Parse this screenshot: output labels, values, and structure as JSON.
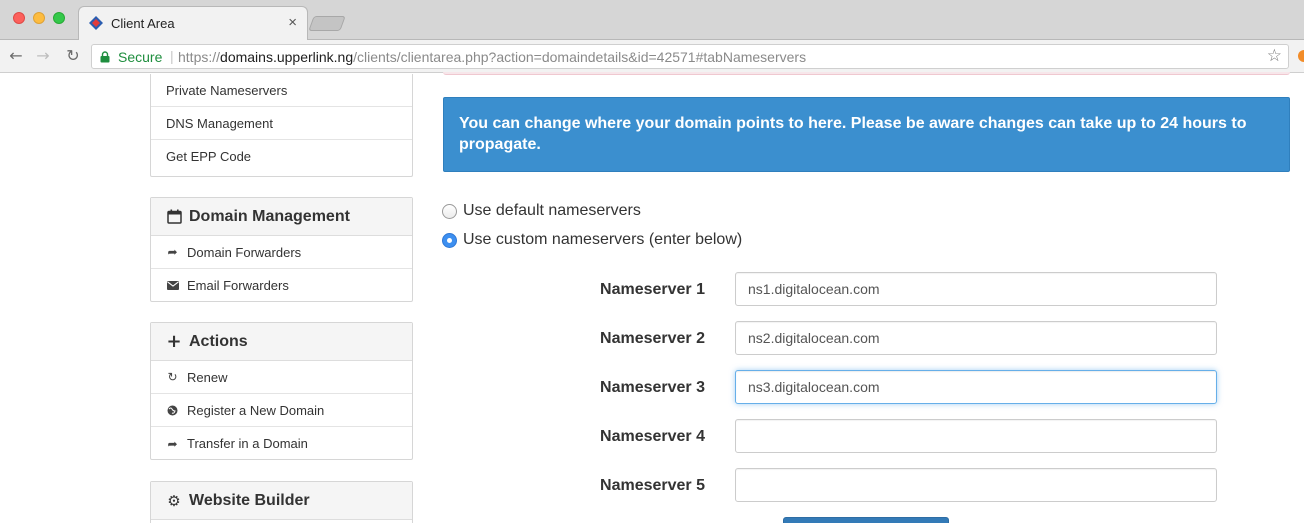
{
  "browser": {
    "tab_title": "Client Area",
    "tab_close": "×",
    "secure_label": "Secure",
    "url_scheme": "https://",
    "url_host": "domains.upperlink.ng",
    "url_path": "/clients/clientarea.php?action=domaindetails&id=42571#tabNameservers",
    "nav_back": "←",
    "nav_forward": "→",
    "nav_reload": "↻",
    "star": "☆"
  },
  "sidebar": {
    "top_items": [
      {
        "label": "Private Nameservers"
      },
      {
        "label": "DNS Management"
      },
      {
        "label": "Get EPP Code"
      }
    ],
    "domain_management": {
      "title": "Domain Management",
      "icon": "calendar-icon",
      "items": [
        {
          "label": "Domain Forwarders",
          "icon": "share-icon"
        },
        {
          "label": "Email Forwarders",
          "icon": "envelope-icon"
        }
      ]
    },
    "actions": {
      "title": "Actions",
      "icon": "plus-icon",
      "items": [
        {
          "label": "Renew",
          "icon": "refresh-icon"
        },
        {
          "label": "Register a New Domain",
          "icon": "globe-icon"
        },
        {
          "label": "Transfer in a Domain",
          "icon": "share-icon"
        }
      ]
    },
    "website_builder": {
      "title": "Website Builder",
      "icon": "cogs-icon"
    }
  },
  "main": {
    "alert_text": "You can change where your domain points to here. Please be aware changes can take up to 24 hours to propagate.",
    "radio_default": {
      "label": "Use default nameservers",
      "checked": false
    },
    "radio_custom": {
      "label": "Use custom nameservers (enter below)",
      "checked": true
    },
    "nameservers": [
      {
        "label": "Nameserver 1",
        "value": "ns1.digitalocean.com"
      },
      {
        "label": "Nameserver 2",
        "value": "ns2.digitalocean.com"
      },
      {
        "label": "Nameserver 3",
        "value": "ns3.digitalocean.com"
      },
      {
        "label": "Nameserver 4",
        "value": ""
      },
      {
        "label": "Nameserver 5",
        "value": ""
      }
    ]
  },
  "colors": {
    "alert_bg": "#3b8fcf",
    "secure_green": "#1e8e3e",
    "primary_button": "#337ab7",
    "focus_border": "#66afe9"
  }
}
